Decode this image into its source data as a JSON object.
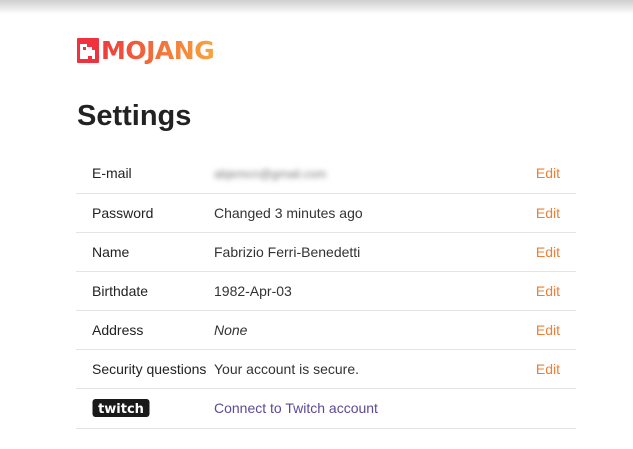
{
  "brand": {
    "logo_text": "MOJANG",
    "accent_color": "#ef323d",
    "logo_gradient": [
      "#ee3a3a",
      "#f6a63c"
    ]
  },
  "page": {
    "title": "Settings"
  },
  "settings": {
    "rows": [
      {
        "label": "E-mail",
        "value": "abjemcn@gmail.com",
        "action": "Edit",
        "value_style": "blurred"
      },
      {
        "label": "Password",
        "value": "Changed 3 minutes ago",
        "action": "Edit"
      },
      {
        "label": "Name",
        "value": "Fabrizio Ferri-Benedetti",
        "action": "Edit"
      },
      {
        "label": "Birthdate",
        "value": "1982-Apr-03",
        "action": "Edit"
      },
      {
        "label": "Address",
        "value": "None",
        "action": "Edit",
        "value_style": "italic"
      },
      {
        "label": "Security questions",
        "value": "Your account is secure.",
        "action": "Edit"
      }
    ],
    "twitch": {
      "logo_text": "twitch",
      "logo_icon": "twitch-logo-icon",
      "link_text": "Connect to Twitch account"
    }
  },
  "colors": {
    "edit_link": "#e9803a",
    "twitch_link": "#5c4a96",
    "divider": "#e4e4e4"
  }
}
